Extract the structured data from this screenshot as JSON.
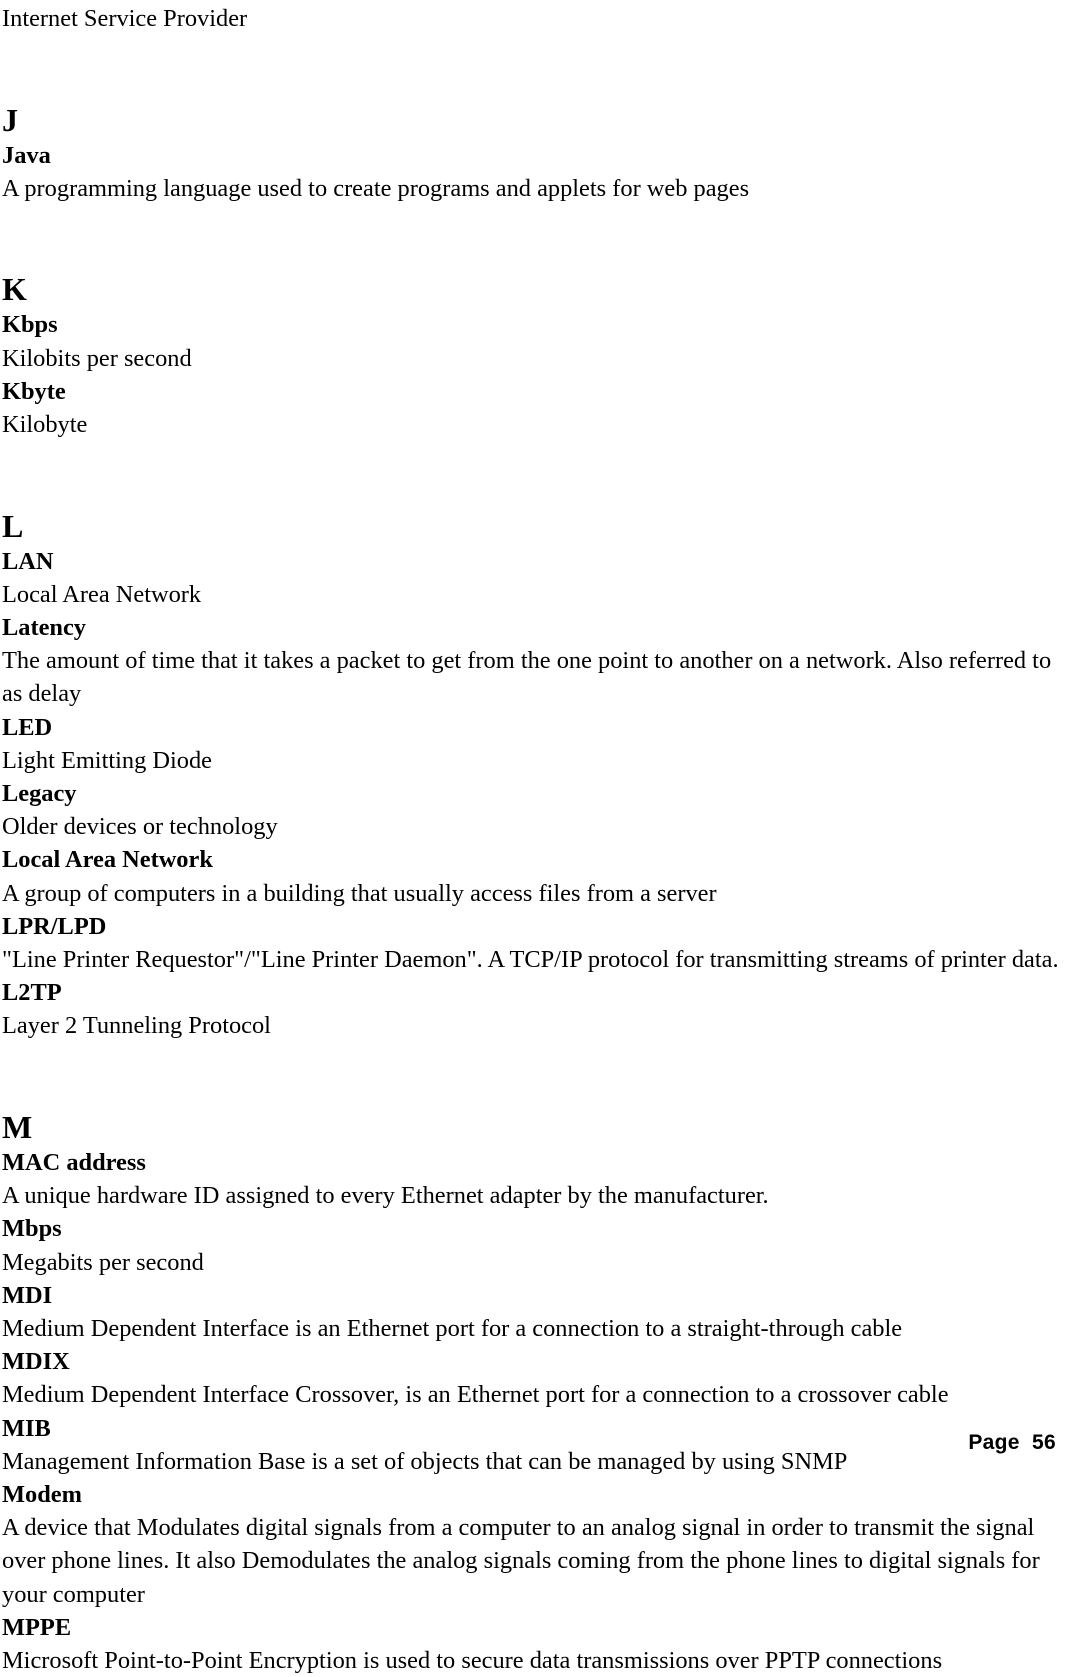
{
  "document": {
    "type": "glossary",
    "page_label": "Page  56",
    "page_number": 56
  },
  "continued_text": {
    "line": "Internet Service Provider"
  },
  "sections": [
    {
      "letter": "J",
      "entries": [
        {
          "term": "Java",
          "definition": "A programming language used to create programs and applets for web pages"
        }
      ]
    },
    {
      "letter": "K",
      "entries": [
        {
          "term": "Kbps",
          "definition": "Kilobits per second"
        },
        {
          "term": "Kbyte",
          "definition": "Kilobyte"
        }
      ]
    },
    {
      "letter": "L",
      "entries": [
        {
          "term": "LAN",
          "definition": "Local Area Network"
        },
        {
          "term": "Latency",
          "definition": "The amount of time that it takes a packet to get from the one point to another on a network. Also referred to as delay"
        },
        {
          "term": "LED",
          "definition": "Light Emitting Diode"
        },
        {
          "term": "Legacy",
          "definition": "Older devices or technology"
        },
        {
          "term": "Local Area Network",
          "definition": "A group of computers in a building that usually access files from a server"
        },
        {
          "term": "LPR/LPD",
          "definition": "\"Line Printer Requestor\"/\"Line Printer Daemon\". A TCP/IP protocol for transmitting streams of printer data."
        },
        {
          "term": "L2TP",
          "definition": "Layer 2 Tunneling Protocol"
        }
      ]
    },
    {
      "letter": "M",
      "entries": [
        {
          "term": "MAC address",
          "definition": "A unique hardware ID assigned to every Ethernet adapter by the manufacturer."
        },
        {
          "term": "Mbps",
          "definition": "Megabits per second"
        },
        {
          "term": "MDI",
          "definition": "Medium Dependent Interface is an Ethernet port for a connection to a straight-through cable"
        },
        {
          "term": "MDIX",
          "definition": "Medium Dependent Interface Crossover, is an Ethernet port for a connection to a crossover cable"
        },
        {
          "term": "MIB",
          "definition": "Management Information Base is a set of objects that can be managed by using SNMP"
        },
        {
          "term": "Modem",
          "definition": "A device that Modulates digital signals from a computer to an analog signal in order to transmit the signal over phone lines. It also Demodulates the analog signals coming from the phone lines to digital signals for your computer"
        },
        {
          "term": "MPPE",
          "definition": "Microsoft Point-to-Point Encryption is used to secure data transmissions over PPTP connections"
        }
      ]
    }
  ]
}
